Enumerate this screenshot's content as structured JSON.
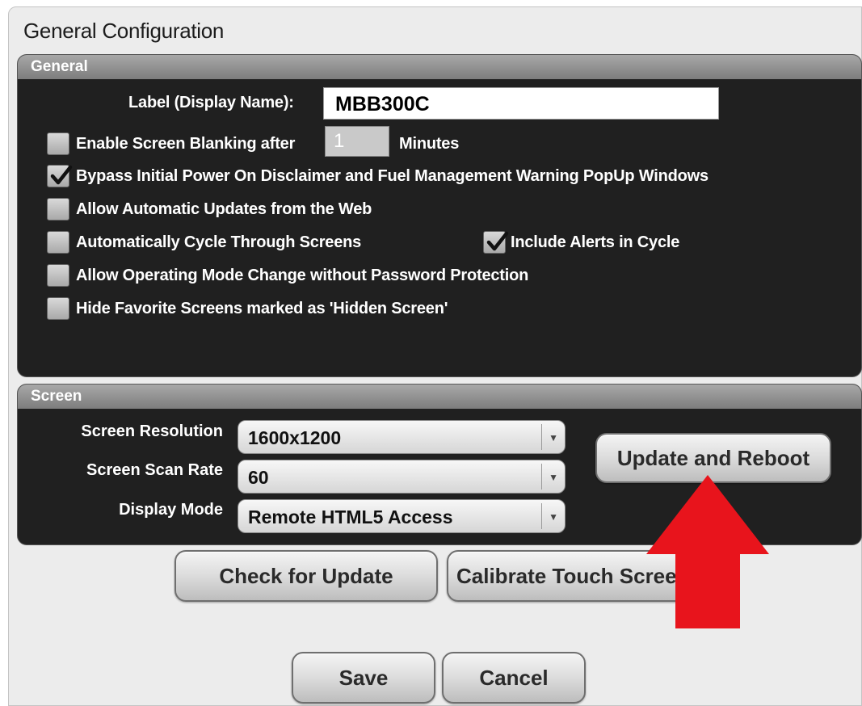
{
  "window": {
    "title": "General Configuration"
  },
  "general": {
    "header": "General",
    "label_caption": "Label (Display Name):",
    "label_value": "MBB300C",
    "blanking": {
      "label": "Enable Screen Blanking after",
      "minutes_value": "1",
      "minutes_label": "Minutes",
      "checked": false
    },
    "bypass": {
      "label": "Bypass Initial Power On Disclaimer and Fuel Management Warning PopUp Windows",
      "checked": true
    },
    "auto_updates": {
      "label": "Allow Automatic Updates from the Web",
      "checked": false
    },
    "cycle": {
      "label": "Automatically Cycle Through Screens",
      "checked": false
    },
    "include_alerts": {
      "label": "Include Alerts in Cycle",
      "checked": true
    },
    "mode_change": {
      "label": "Allow Operating Mode Change without Password Protection",
      "checked": false
    },
    "hide_favorites": {
      "label": "Hide Favorite Screens marked as 'Hidden Screen'",
      "checked": false
    }
  },
  "screen": {
    "header": "Screen",
    "resolution": {
      "label": "Screen Resolution",
      "value": "1600x1200"
    },
    "scan_rate": {
      "label": "Screen Scan Rate",
      "value": "60"
    },
    "display_mode": {
      "label": "Display Mode",
      "value": "Remote HTML5 Access"
    },
    "update_reboot_label": "Update and Reboot"
  },
  "buttons": {
    "check_update": "Check for Update",
    "calibrate": "Calibrate Touch Scree",
    "save": "Save",
    "cancel": "Cancel"
  },
  "colors": {
    "panel_bg": "#202020",
    "panel_header": "#8e8e8e",
    "window_bg": "#ececec",
    "annotation_arrow": "#e8141c"
  },
  "icons": {
    "checkmark": "check-icon",
    "dropdown": "chevron-down-icon",
    "annotation": "arrow-up-icon"
  }
}
